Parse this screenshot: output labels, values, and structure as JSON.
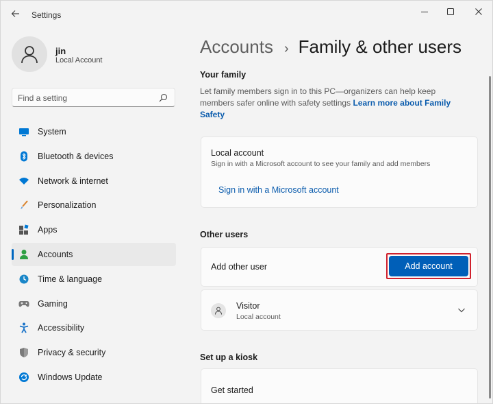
{
  "window": {
    "title": "Settings"
  },
  "profile": {
    "name": "jin",
    "account_type": "Local Account"
  },
  "search": {
    "placeholder": "Find a setting"
  },
  "sidebar": {
    "items": [
      {
        "label": "System",
        "icon": "monitor-icon",
        "color": "#0078d4"
      },
      {
        "label": "Bluetooth & devices",
        "icon": "bluetooth-icon",
        "color": "#0078d4"
      },
      {
        "label": "Network & internet",
        "icon": "wifi-icon",
        "color": "#0078d4"
      },
      {
        "label": "Personalization",
        "icon": "brush-icon",
        "color": "#d9822b"
      },
      {
        "label": "Apps",
        "icon": "apps-icon",
        "color": "#555555"
      },
      {
        "label": "Accounts",
        "icon": "person-icon",
        "color": "#2ea043",
        "active": true
      },
      {
        "label": "Time & language",
        "icon": "globe-clock-icon",
        "color": "#1a86c8"
      },
      {
        "label": "Gaming",
        "icon": "gamepad-icon",
        "color": "#666666"
      },
      {
        "label": "Accessibility",
        "icon": "accessibility-icon",
        "color": "#1a73c8"
      },
      {
        "label": "Privacy & security",
        "icon": "shield-icon",
        "color": "#666666"
      },
      {
        "label": "Windows Update",
        "icon": "update-icon",
        "color": "#0078d4"
      }
    ]
  },
  "breadcrumb": {
    "parent": "Accounts",
    "separator": "›",
    "current": "Family & other users"
  },
  "family": {
    "heading": "Your family",
    "description": "Let family members sign in to this PC—organizers can help keep members safer online with safety settings",
    "learn_more": "Learn more about Family Safety"
  },
  "local_account_card": {
    "title": "Local account",
    "subtitle": "Sign in with a Microsoft account to see your family and add members",
    "link": "Sign in with a Microsoft account"
  },
  "other_users": {
    "heading": "Other users",
    "add_label": "Add other user",
    "add_button": "Add account",
    "highlight_color": "#d0212d",
    "visitor_name": "Visitor",
    "visitor_type": "Local account"
  },
  "kiosk": {
    "heading": "Set up a kiosk",
    "get_started": "Get started"
  },
  "colors": {
    "accent": "#005fb8",
    "link": "#0b5cad"
  }
}
